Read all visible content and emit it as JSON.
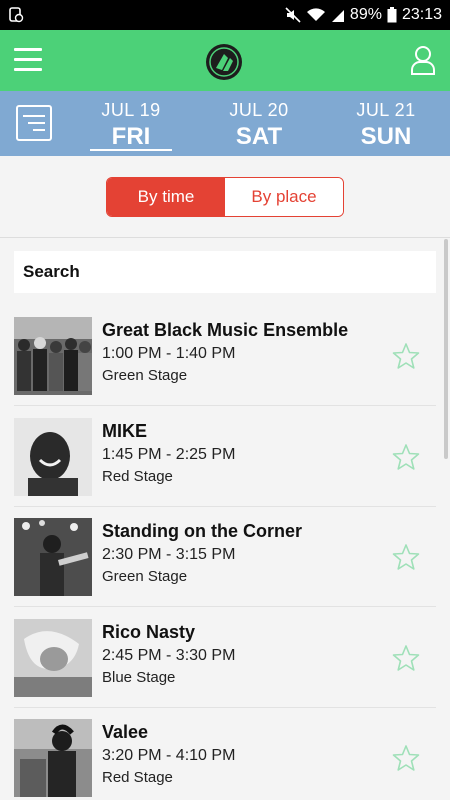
{
  "status": {
    "battery": "89%",
    "time": "23:13"
  },
  "header": {
    "menu_icon": "hamburger-icon",
    "logo": "festival-logo",
    "profile_icon": "user-icon"
  },
  "days": [
    {
      "month": "JUL 19",
      "day": "FRI",
      "active": true
    },
    {
      "month": "JUL 20",
      "day": "SAT",
      "active": false
    },
    {
      "month": "JUL 21",
      "day": "SUN",
      "active": false
    }
  ],
  "view_toggle": {
    "by_time": "By time",
    "by_place": "By place",
    "selected": "By time"
  },
  "search": {
    "label": "Search"
  },
  "events": [
    {
      "name": "Great Black Music Ensemble",
      "time": "1:00 PM - 1:40 PM",
      "stage": "Green Stage"
    },
    {
      "name": "MIKE",
      "time": "1:45 PM - 2:25 PM",
      "stage": "Red Stage"
    },
    {
      "name": "Standing on the Corner",
      "time": "2:30 PM - 3:15 PM",
      "stage": "Green Stage"
    },
    {
      "name": "Rico Nasty",
      "time": "2:45 PM - 3:30 PM",
      "stage": "Blue Stage"
    },
    {
      "name": "Valee",
      "time": "3:20 PM - 4:10 PM",
      "stage": "Red Stage"
    }
  ],
  "colors": {
    "app_bar": "#4cd178",
    "date_bar": "#80a9d2",
    "accent": "#e44234",
    "star": "#9fe0b8"
  }
}
